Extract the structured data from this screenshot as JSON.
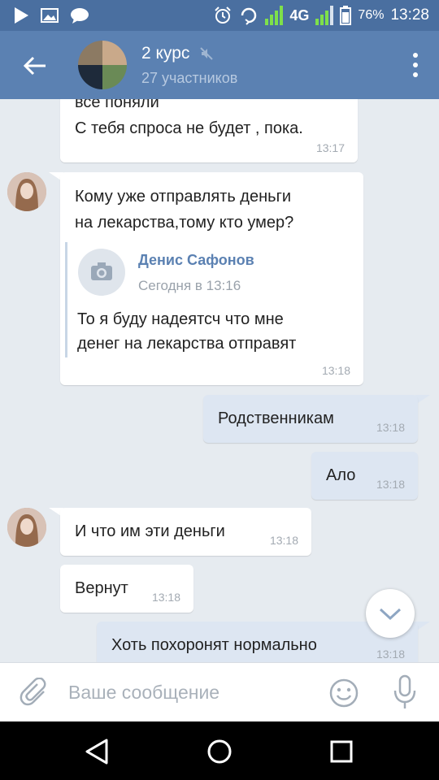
{
  "status_bar": {
    "battery": "76%",
    "network": "4G",
    "time": "13:28"
  },
  "header": {
    "title": "2 курс",
    "subtitle": "27 участников"
  },
  "messages": [
    {
      "id": "m1",
      "direction": "in",
      "text": "все поняли\nС тебя спроса не будет , пока.",
      "time": "13:17"
    },
    {
      "id": "m2",
      "direction": "in",
      "text": "Кому уже отправлять деньги\nна лекарства,тому кто умер?",
      "time": "13:18",
      "forwarded": {
        "author": "Денис Сафонов",
        "date": "Сегодня в 13:16",
        "text": "То я буду надеятсч что мне\nденег на лекарства отправят"
      }
    },
    {
      "id": "m3",
      "direction": "out",
      "text": "Родственникам",
      "time": "13:18"
    },
    {
      "id": "m4",
      "direction": "out",
      "text": "Ало",
      "time": "13:18"
    },
    {
      "id": "m5",
      "direction": "in",
      "text": "И что им эти деньги",
      "time": "13:18"
    },
    {
      "id": "m6",
      "direction": "in",
      "text": "Вернут",
      "time": "13:18"
    },
    {
      "id": "m7",
      "direction": "out",
      "text": "Хоть похоронят нормально",
      "time": "13:18"
    }
  ],
  "composer": {
    "placeholder": "Ваше сообщение"
  },
  "colors": {
    "status_bar": "#4a6fa0",
    "toolbar": "#5b81b2",
    "chat_bg": "#e6ebf0",
    "incoming_bubble": "#ffffff",
    "outgoing_bubble": "#dde6f2",
    "accent": "#5b81b2"
  },
  "icons": {
    "status_left": [
      "play-store-icon",
      "image-icon",
      "chat-bubble-icon"
    ],
    "status_right": [
      "alarm-icon",
      "sync-icon",
      "signal-icon",
      "battery-icon"
    ],
    "toolbar": [
      "back-arrow-icon",
      "muted-icon",
      "more-vertical-icon"
    ],
    "composer": [
      "attach-icon",
      "emoji-icon",
      "mic-icon"
    ],
    "navigation": [
      "nav-back-icon",
      "nav-home-icon",
      "nav-recents-icon"
    ]
  }
}
